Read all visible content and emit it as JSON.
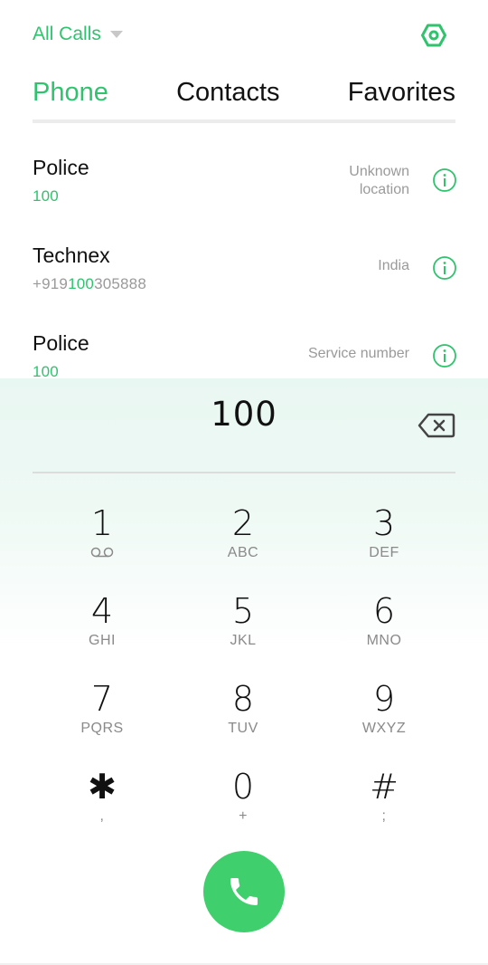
{
  "header": {
    "filter_label": "All Calls",
    "icons": {
      "filter": "chevron-down-icon",
      "settings": "settings-icon"
    }
  },
  "tabs": [
    {
      "label": "Phone",
      "active": true
    },
    {
      "label": "Contacts",
      "active": false
    },
    {
      "label": "Favorites",
      "active": false
    }
  ],
  "results": [
    {
      "name": "Police",
      "number_parts": [
        "",
        "100",
        ""
      ],
      "location_line1": "Unknown",
      "location_line2": "location"
    },
    {
      "name": "Technex",
      "number_parts": [
        "+919",
        "100",
        "305888"
      ],
      "location_line1": "India",
      "location_line2": ""
    },
    {
      "name": "Police",
      "number_parts": [
        "",
        "100",
        ""
      ],
      "location_line1": "Service number",
      "location_line2": ""
    }
  ],
  "dialpad": {
    "entry": "100",
    "keys": [
      {
        "digit": "1",
        "letters": ""
      },
      {
        "digit": "2",
        "letters": "ABC"
      },
      {
        "digit": "3",
        "letters": "DEF"
      },
      {
        "digit": "4",
        "letters": "GHI"
      },
      {
        "digit": "5",
        "letters": "JKL"
      },
      {
        "digit": "6",
        "letters": "MNO"
      },
      {
        "digit": "7",
        "letters": "PQRS"
      },
      {
        "digit": "8",
        "letters": "TUV"
      },
      {
        "digit": "9",
        "letters": "WXYZ"
      },
      {
        "digit": "✱",
        "letters": ","
      },
      {
        "digit": "0",
        "letters": "+"
      },
      {
        "digit": "#",
        "letters": ";"
      }
    ]
  },
  "colors": {
    "accent": "#2fc36e",
    "call_button": "#3fcf6c"
  }
}
